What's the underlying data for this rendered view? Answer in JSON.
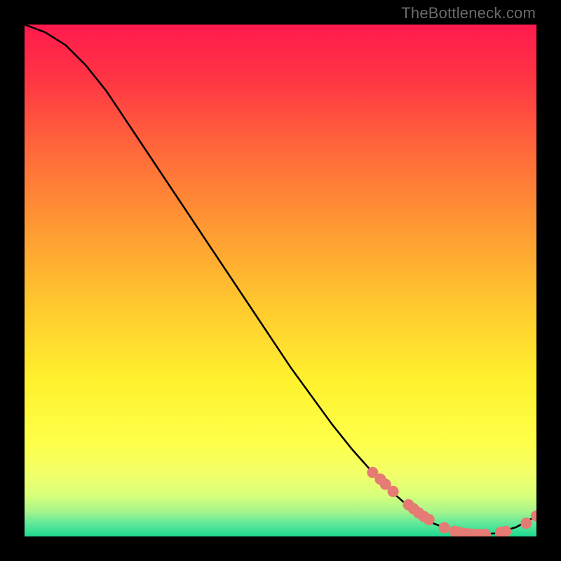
{
  "chart_data": {
    "type": "line",
    "title": "",
    "xlabel": "",
    "ylabel": "",
    "xlim": [
      0,
      100
    ],
    "ylim": [
      0,
      100
    ],
    "x": [
      0,
      4,
      8,
      12,
      16,
      20,
      24,
      28,
      32,
      36,
      40,
      44,
      48,
      52,
      56,
      60,
      64,
      68,
      72,
      76,
      80,
      84,
      88,
      92,
      96,
      100
    ],
    "values": [
      100,
      98.5,
      96,
      92,
      87,
      81,
      75,
      69,
      63,
      57,
      51,
      45,
      39,
      33,
      27.5,
      22,
      17,
      12.5,
      8.5,
      5,
      2.5,
      1,
      0.4,
      0.6,
      1.8,
      4
    ],
    "markers": [
      {
        "x": 68,
        "y": 12.5,
        "r": 1.1
      },
      {
        "x": 69.5,
        "y": 11.2,
        "r": 1.1
      },
      {
        "x": 70.5,
        "y": 10.2,
        "r": 1.1
      },
      {
        "x": 72,
        "y": 8.8,
        "r": 1.1
      },
      {
        "x": 75,
        "y": 6.2,
        "r": 1.1
      },
      {
        "x": 76,
        "y": 5.4,
        "r": 1.1
      },
      {
        "x": 77,
        "y": 4.6,
        "r": 1.1
      },
      {
        "x": 78,
        "y": 3.9,
        "r": 1.1
      },
      {
        "x": 79,
        "y": 3.3,
        "r": 1.1
      },
      {
        "x": 82,
        "y": 1.7,
        "r": 1.1
      },
      {
        "x": 84,
        "y": 1.0,
        "r": 1.1
      },
      {
        "x": 85,
        "y": 0.8,
        "r": 1.1
      },
      {
        "x": 86,
        "y": 0.6,
        "r": 1.1
      },
      {
        "x": 87,
        "y": 0.5,
        "r": 1.1
      },
      {
        "x": 88,
        "y": 0.4,
        "r": 1.1
      },
      {
        "x": 89,
        "y": 0.4,
        "r": 1.1
      },
      {
        "x": 90,
        "y": 0.4,
        "r": 1.1
      },
      {
        "x": 93,
        "y": 0.8,
        "r": 1.1
      },
      {
        "x": 94,
        "y": 1.0,
        "r": 1.1
      },
      {
        "x": 98,
        "y": 2.6,
        "r": 1.1
      },
      {
        "x": 100,
        "y": 4.0,
        "r": 1.1
      }
    ]
  },
  "gradient_stops": [
    {
      "offset": 0.0,
      "color": "#ff1a4d"
    },
    {
      "offset": 0.1,
      "color": "#ff3344"
    },
    {
      "offset": 0.25,
      "color": "#ff6a3a"
    },
    {
      "offset": 0.4,
      "color": "#ff9a33"
    },
    {
      "offset": 0.55,
      "color": "#ffc92e"
    },
    {
      "offset": 0.7,
      "color": "#fff22e"
    },
    {
      "offset": 0.82,
      "color": "#fdff4a"
    },
    {
      "offset": 0.88,
      "color": "#f1ff6a"
    },
    {
      "offset": 0.92,
      "color": "#d7ff7a"
    },
    {
      "offset": 0.95,
      "color": "#a9f58b"
    },
    {
      "offset": 0.975,
      "color": "#5fe89a"
    },
    {
      "offset": 1.0,
      "color": "#1ed98f"
    }
  ],
  "marker_color": "#e57b74",
  "curve_color": "#000000",
  "watermark": "TheBottleneck.com"
}
